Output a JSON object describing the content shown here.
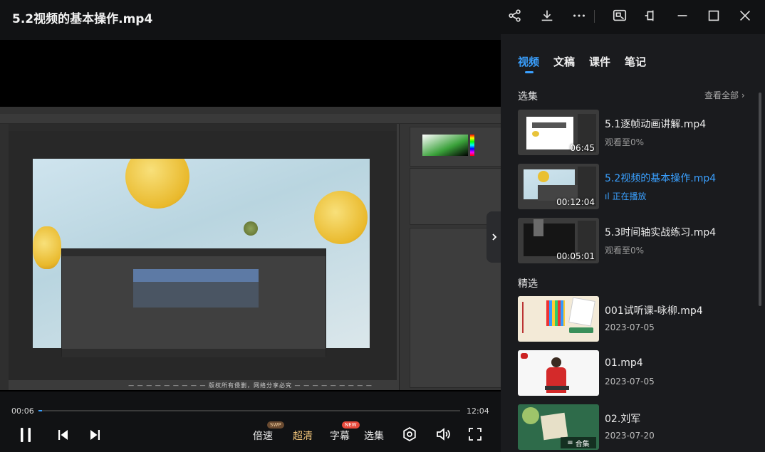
{
  "window": {
    "title": "5.2视频的基本操作.mp4",
    "icons": [
      "share-icon",
      "download-icon",
      "more-icon",
      "mini-window-icon",
      "pin-icon",
      "minimize-icon",
      "maximize-icon",
      "close-icon"
    ]
  },
  "video": {
    "caption": "— — — — — — — — —  版权所有侵删，网络分享必究  — — — — — — — — —"
  },
  "player": {
    "current_time": "00:06",
    "duration": "12:04",
    "progress_fraction": 0.008,
    "speed_label": "倍速",
    "speed_badge": "SWP",
    "quality_label": "超清",
    "subtitle_label": "字幕",
    "subtitle_badge": "NEW",
    "episodes_label": "选集",
    "accent_color": "#3aa0ff"
  },
  "sidebar": {
    "tabs": [
      {
        "label": "视频",
        "active": true
      },
      {
        "label": "文稿",
        "active": false
      },
      {
        "label": "课件",
        "active": false
      },
      {
        "label": "笔记",
        "active": false
      }
    ],
    "episodes": {
      "heading": "选集",
      "view_all": "查看全部",
      "items": [
        {
          "title": "5.1逐帧动画讲解.mp4",
          "duration": "06:45",
          "sub": "观看至0%",
          "current": false
        },
        {
          "title": "5.2视频的基本操作.mp4",
          "duration": "00:12:04",
          "sub": "正在播放",
          "current": true
        },
        {
          "title": "5.3时间轴实战练习.mp4",
          "duration": "00:05:01",
          "sub": "观看至0%",
          "current": false
        }
      ]
    },
    "featured": {
      "heading": "精选",
      "items": [
        {
          "title": "001试听课-咏柳.mp4",
          "date": "2023-07-05"
        },
        {
          "title": "01.mp4",
          "date": "2023-07-05"
        },
        {
          "title": "02.刘军",
          "date": "2023-07-20",
          "badge": "合集"
        }
      ]
    }
  }
}
